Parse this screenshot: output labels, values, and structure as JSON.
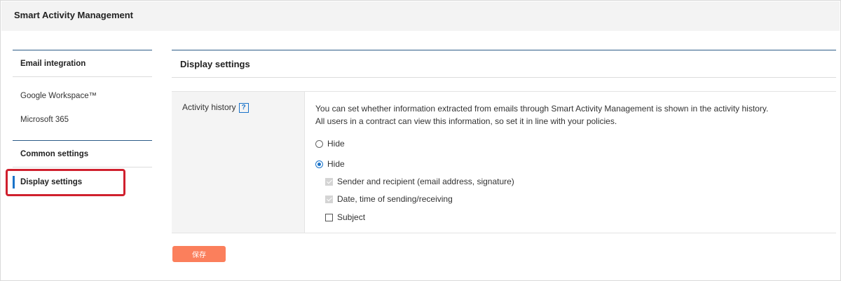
{
  "app": {
    "title": "Smart Activity Management"
  },
  "sidebar": {
    "section1": {
      "heading": "Email integration",
      "items": [
        {
          "label": "Google Workspace™"
        },
        {
          "label": "Microsoft 365"
        }
      ]
    },
    "section2": {
      "heading": "Common settings",
      "items": [
        {
          "label": "Display settings",
          "active": true
        }
      ]
    },
    "accent_color": "#1a73c9",
    "highlight_color": "#d0202e"
  },
  "main": {
    "heading": "Display settings",
    "row": {
      "label": "Activity history",
      "help_glyph": "?",
      "description": [
        "You can set whether information extracted from emails through Smart Activity Management is shown in the activity history.",
        "All users in a contract can view this information, so set it in line with your policies."
      ],
      "options": [
        {
          "label": "Hide",
          "selected": false
        },
        {
          "label": "Hide",
          "selected": true
        }
      ],
      "checkboxes": [
        {
          "label": "Sender and recipient (email address, signature)",
          "checked": true,
          "disabled": true
        },
        {
          "label": "Date, time of sending/receiving",
          "checked": true,
          "disabled": true
        },
        {
          "label": "Subject",
          "checked": false,
          "disabled": false
        }
      ]
    },
    "save_label": "保存",
    "save_color": "#fb7f5c"
  }
}
